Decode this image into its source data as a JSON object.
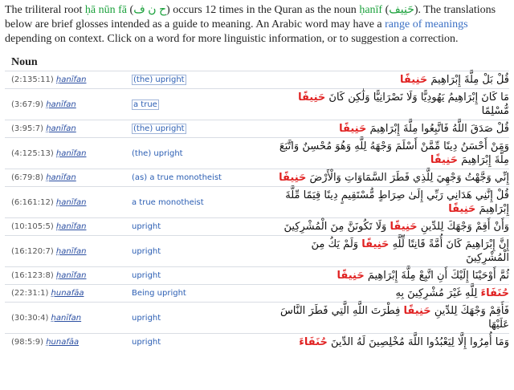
{
  "intro": {
    "p1": "The triliteral root ",
    "root_translit": "ḥā nūn fā",
    "p2": " (",
    "root_arabic": "ح ن ف",
    "p3": ") occurs 12 times in the Quran as the noun ",
    "noun_translit": "ḥanīf",
    "p4": " (",
    "noun_arabic": "حَنِيف",
    "p5": "). The translations below are brief glosses intended as a guide to meaning. An Arabic word may have a ",
    "link": "range of meanings",
    "p6": " depending on context. Click on a word for more linguistic information, or to suggestion a correction."
  },
  "heading": "Noun",
  "colors": {
    "link": "#3a6fc4",
    "root": "#19a03a",
    "highlight": "#e02020",
    "gloss": "#2b5eb3",
    "rule": "#d9dde4"
  },
  "rows": [
    {
      "ref": "(2:135:11)",
      "translit": "ḥanīfan",
      "gloss": "(the) upright",
      "boxed": true,
      "ar_before": "قُلْ بَلْ مِلَّةَ إِبْرَاهِيمَ ",
      "ar_word": "حَنِيفًا",
      "ar_after": ""
    },
    {
      "ref": "(3:67:9)",
      "translit": "ḥanīfan",
      "gloss": "a true",
      "boxed": true,
      "ar_before": "مَا كَانَ إِبْرَاهِيمُ يَهُودِيًّا وَلَا نَصْرَانِيًّا وَلَٰكِن كَانَ ",
      "ar_word": "حَنِيفًا",
      "ar_after": " مُّسْلِمًا"
    },
    {
      "ref": "(3:95:7)",
      "translit": "ḥanīfan",
      "gloss": "(the) upright",
      "boxed": true,
      "ar_before": "قُلْ صَدَقَ اللَّهُ فَاتَّبِعُوا مِلَّةَ إِبْرَاهِيمَ ",
      "ar_word": "حَنِيفًا",
      "ar_after": ""
    },
    {
      "ref": "(4:125:13)",
      "translit": "ḥanīfan",
      "gloss": "(the) upright",
      "boxed": false,
      "ar_before": "وَمَنْ أَحْسَنُ دِينًا مِّمَّنْ أَسْلَمَ وَجْهَهُ لِلَّهِ وَهُوَ مُحْسِنٌ وَاتَّبَعَ مِلَّةَ إِبْرَاهِيمَ ",
      "ar_word": "حَنِيفًا",
      "ar_after": ""
    },
    {
      "ref": "(6:79:8)",
      "translit": "ḥanīfan",
      "gloss": "(as) a true monotheist",
      "boxed": false,
      "ar_before": "إِنِّي وَجَّهْتُ وَجْهِيَ لِلَّذِي فَطَرَ السَّمَاوَاتِ وَالْأَرْضَ ",
      "ar_word": "حَنِيفًا",
      "ar_after": ""
    },
    {
      "ref": "(6:161:12)",
      "translit": "ḥanīfan",
      "gloss": "a true monotheist",
      "boxed": false,
      "ar_before": "قُلْ إِنَّنِي هَدَانِي رَبِّي إِلَىٰ صِرَاطٍ مُّسْتَقِيمٍ دِينًا قِيَمًا مِّلَّةَ إِبْرَاهِيمَ ",
      "ar_word": "حَنِيفًا",
      "ar_after": ""
    },
    {
      "ref": "(10:105:5)",
      "translit": "ḥanīfan",
      "gloss": "upright",
      "boxed": false,
      "ar_before": "وَأَنْ أَقِمْ وَجْهَكَ لِلدِّينِ ",
      "ar_word": "حَنِيفًا",
      "ar_after": " وَلَا تَكُونَنَّ مِنَ الْمُشْرِكِينَ"
    },
    {
      "ref": "(16:120:7)",
      "translit": "ḥanīfan",
      "gloss": "upright",
      "boxed": false,
      "ar_before": "إِنَّ إِبْرَاهِيمَ كَانَ أُمَّةً قَانِتًا لِّلَّهِ ",
      "ar_word": "حَنِيفًا",
      "ar_after": " وَلَمْ يَكُ مِنَ الْمُشْرِكِينَ"
    },
    {
      "ref": "(16:123:8)",
      "translit": "ḥanīfan",
      "gloss": "upright",
      "boxed": false,
      "ar_before": "ثُمَّ أَوْحَيْنَا إِلَيْكَ أَنِ اتَّبِعْ مِلَّةَ إِبْرَاهِيمَ ",
      "ar_word": "حَنِيفًا",
      "ar_after": ""
    },
    {
      "ref": "(22:31:1)",
      "translit": "ḥunafāa",
      "gloss": "Being upright",
      "boxed": false,
      "ar_before": "",
      "ar_word": "حُنَفَاءَ",
      "ar_after": " لِلَّهِ غَيْرَ مُشْرِكِينَ بِهِ"
    },
    {
      "ref": "(30:30:4)",
      "translit": "ḥanīfan",
      "gloss": "upright",
      "boxed": false,
      "ar_before": "فَأَقِمْ وَجْهَكَ لِلدِّينِ ",
      "ar_word": "حَنِيفًا",
      "ar_after": " فِطْرَتَ اللَّهِ الَّتِي فَطَرَ النَّاسَ عَلَيْهَا"
    },
    {
      "ref": "(98:5:9)",
      "translit": "ḥunafāa",
      "gloss": "upright",
      "boxed": false,
      "ar_before": "وَمَا أُمِرُوا إِلَّا لِيَعْبُدُوا اللَّهَ مُخْلِصِينَ لَهُ الدِّينَ ",
      "ar_word": "حُنَفَاءَ",
      "ar_after": ""
    }
  ]
}
